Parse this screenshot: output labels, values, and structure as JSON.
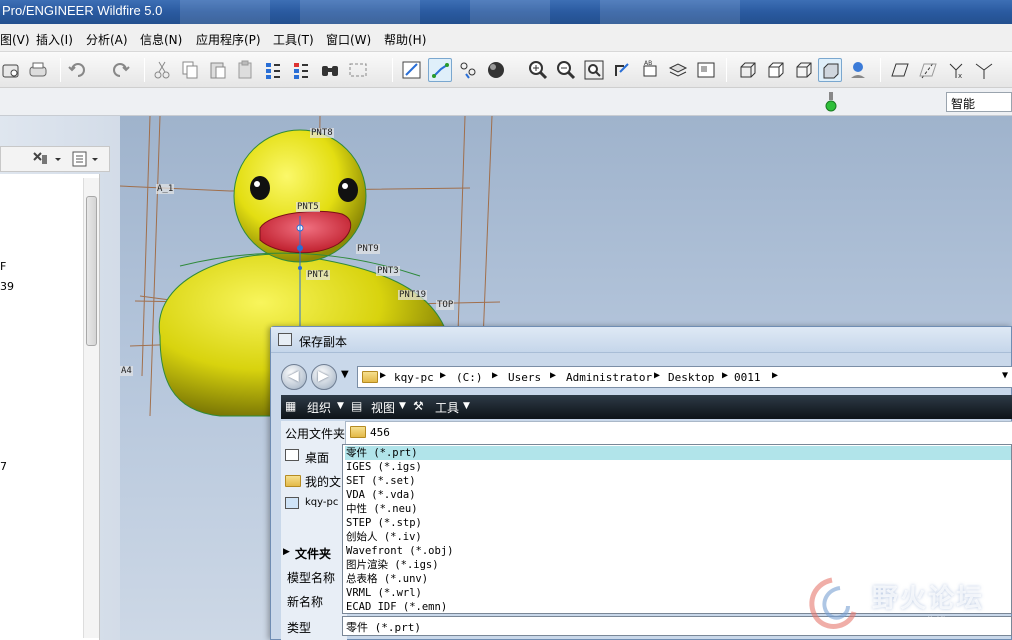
{
  "window": {
    "title": "Pro/ENGINEER Wildfire 5.0"
  },
  "menu": [
    {
      "id": "view",
      "label": "图(V)"
    },
    {
      "id": "insert",
      "label": "插入(I)"
    },
    {
      "id": "analysis",
      "label": "分析(A)"
    },
    {
      "id": "info",
      "label": "信息(N)"
    },
    {
      "id": "applications",
      "label": "应用程序(P)"
    },
    {
      "id": "tools",
      "label": "工具(T)"
    },
    {
      "id": "window",
      "label": "窗口(W)"
    },
    {
      "id": "help",
      "label": "帮助(H)"
    }
  ],
  "filter": {
    "value": "智能"
  },
  "model_tree": {
    "fragments": [
      "F",
      "39",
      "7"
    ]
  },
  "datum_labels": [
    "PNT8",
    "PNT5",
    "PNT9",
    "PNT3",
    "PNT4",
    "PNT19",
    "TOP",
    "A_1",
    "A4"
  ],
  "dialog": {
    "title": "保存副本",
    "breadcrumb": [
      "kqy-pc",
      "(C:)",
      "Users",
      "Administrator",
      "Desktop",
      "0011"
    ],
    "toolbar": {
      "organize": "组织",
      "views": "视图",
      "tools": "工具"
    },
    "sidebar": [
      {
        "label": "公用文件夹"
      },
      {
        "label": "桌面"
      },
      {
        "label": "我的文"
      },
      {
        "label": "kqy-pc"
      }
    ],
    "folders": [
      {
        "name": "456"
      }
    ],
    "folder_tree_label": "文件夹",
    "fields": {
      "model_name": "模型名称",
      "new_name": "新名称",
      "type": "类型"
    },
    "type_selected": "零件 (*.prt)",
    "type_options": [
      "零件 (*.prt)",
      "IGES (*.igs)",
      "SET (*.set)",
      "VDA (*.vda)",
      "中性 (*.neu)",
      "STEP (*.stp)",
      "创始人 (*.iv)",
      "Wavefront (*.obj)",
      "图片渲染 (*.igs)",
      "总表格 (*.unv)",
      "VRML (*.wrl)",
      "ECAD IDF (*.emn)"
    ]
  },
  "watermark": {
    "text": "野火论坛",
    "url": "www.proewildfire.cn"
  },
  "colors": {
    "selection": "#b1e4ea",
    "duck_yellow": "#e6e21a",
    "beak": "#d8353f"
  },
  "icons": [
    "save-icon",
    "print-icon",
    "undo-icon",
    "redo-icon",
    "cut-icon",
    "copy-icon",
    "paste-icon",
    "regenerate-icon",
    "find-icon",
    "select-box-icon",
    "zoom-in-icon",
    "zoom-out-icon",
    "refit-icon",
    "datum-plane-icon"
  ]
}
